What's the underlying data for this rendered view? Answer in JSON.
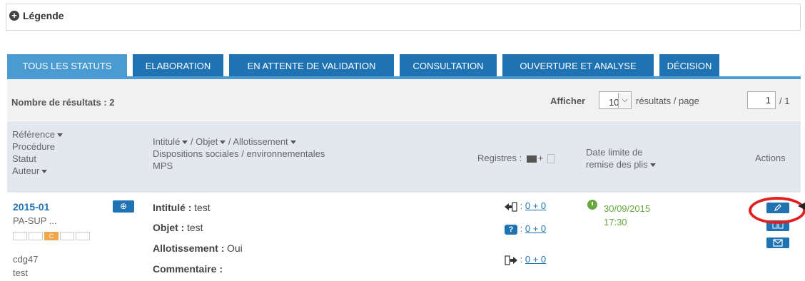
{
  "legend": {
    "icon": "plus-circle-icon",
    "label": "Légende"
  },
  "tabs": [
    {
      "label": "TOUS LES STATUTS",
      "active": true
    },
    {
      "label": "ELABORATION"
    },
    {
      "label": "EN ATTENTE DE VALIDATION"
    },
    {
      "label": "CONSULTATION"
    },
    {
      "label": "OUVERTURE ET ANALYSE"
    },
    {
      "label": "DÉCISION"
    }
  ],
  "results": {
    "count_label": "Nombre de résultats : 2",
    "afficher": "Afficher",
    "per_page_value": "10",
    "per_page_suffix": "résultats / page",
    "page_value": "1",
    "page_total": "/ 1"
  },
  "header": {
    "col1": [
      "Référence",
      "Procédure",
      "Statut",
      "Auteur"
    ],
    "col2_line1_a": "Intitulé",
    "col2_line1_b": "/ Objet",
    "col2_line1_c": "/ Allotissement",
    "col2_line2": "Dispositions sociales / environnementales",
    "col2_line3": "MPS",
    "registres": "Registres :",
    "registres_plus": "+",
    "date_line1": "Date limite de",
    "date_line2": "remise des plis",
    "actions": "Actions"
  },
  "row": {
    "reference": "2015-01",
    "procedure": "PA-SUP ...",
    "status_cells": [
      "",
      "",
      "C",
      "",
      ""
    ],
    "author_line1": "cdg47",
    "author_line2": "test",
    "intitule_label": "Intitulé :",
    "intitule_value": "test",
    "objet_label": "Objet :",
    "objet_value": "test",
    "allot_label": "Allotissement :",
    "allot_value": "Oui",
    "commentaire_label": "Commentaire :",
    "registres": [
      {
        "icon": "withdrawal-icon",
        "colon": ":",
        "value": "0 + 0"
      },
      {
        "icon": "question-icon",
        "colon": ":",
        "value": "0 + 0"
      },
      {
        "icon": "deposit-icon",
        "colon": ":",
        "value": "0 + 0"
      }
    ],
    "date": "30/09/2015",
    "time": "17:30"
  },
  "colors": {
    "tab": "#1f73b3",
    "tab_active": "#4a9bd1",
    "link": "#1f73b3",
    "date_green": "#67a73f",
    "status_orange": "#f0a64a",
    "highlight_red": "#e21e1e"
  }
}
